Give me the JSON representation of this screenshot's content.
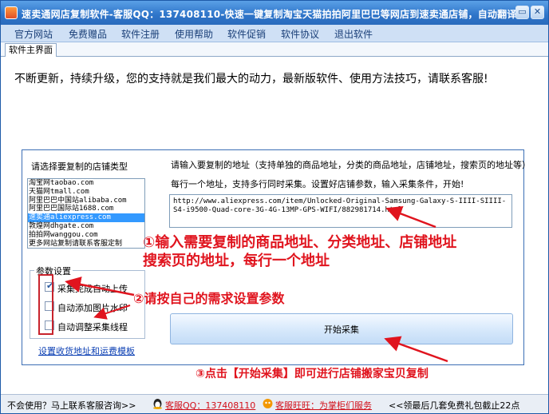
{
  "window": {
    "title": "速卖通网店复制软件-客服QQ：137408110-快速一键复制淘宝天猫拍拍阿里巴巴等网店到速卖通店铺，自动翻译",
    "icon": "app-logo-icon",
    "minimize_glyph": "▭",
    "close_glyph": "✕"
  },
  "menu": {
    "items": [
      "官方网站",
      "免费赠品",
      "软件注册",
      "使用帮助",
      "软件促销",
      "软件协议",
      "退出软件"
    ]
  },
  "tabs": {
    "main": "软件主界面"
  },
  "slogan": "不断更新，持续升级，您的支持就是我们最大的动力，最新版软件、使用方法技巧，请联系客服!",
  "store_type": {
    "label": "请选择要复制的店铺类型",
    "items": [
      "淘宝网taobao.com",
      "天猫网tmall.com",
      "阿里巴巴中国站alibaba.com",
      "阿里巴巴国际站1688.com",
      "速卖通aliexpress.com",
      "敦煌网dhgate.com",
      "拍拍网wanggou.com",
      "更多网站复制请联系客服定制"
    ],
    "selected_index": 4
  },
  "url_input": {
    "label": "请输入要复制的地址（支持单独的商品地址，分类的商品地址，店铺地址，搜索页的地址等）",
    "hint": "每行一个地址，支持多行同时采集。设置好店铺参数，输入采集条件，开始!",
    "value": "http://www.aliexpress.com/item/Unlocked-Original-Samsung-Galaxy-S-IIII-SIIII-S4-i9500-Quad-core-3G-4G-13MP-GPS-WIFI/882981714.html"
  },
  "settings": {
    "title": "参数设置",
    "options": [
      {
        "label": "采集完成自动上传",
        "checked": true
      },
      {
        "label": "自动添加图片水印",
        "checked": false
      },
      {
        "label": "自动调整采集线程",
        "checked": false
      }
    ],
    "link": "设置收货地址和运费模板"
  },
  "start_button": {
    "label": "开始采集"
  },
  "callouts": {
    "step1_line1": "①输入需要复制的商品地址、分类地址、店铺地址",
    "step1_line2": "搜索页的地址，每行一个地址",
    "step2": "②请按自己的需求设置参数",
    "step3": "③点击【开始采集】即可进行店铺搬家宝贝复制"
  },
  "statusbar": {
    "help": "不会使用？马上联系客服咨询>>",
    "qq": "客服QQ：137408110",
    "wangwang": "客服旺旺：为掌柜们服务",
    "promo": "<<领最后几套免费礼包截止22点"
  },
  "colors": {
    "title_blue": "#2e74c9",
    "callout_red": "#e0141e",
    "link_blue": "#0b3fb3",
    "selection_blue": "#3399ff"
  }
}
